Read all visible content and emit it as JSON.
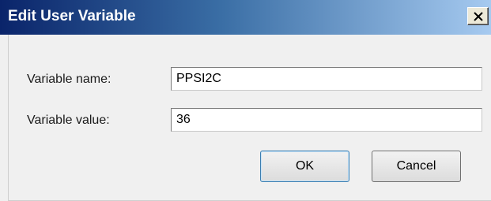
{
  "dialog": {
    "title": "Edit User Variable",
    "close_label": "X"
  },
  "fields": {
    "name_label": "Variable name:",
    "name_value": "PPSI2C",
    "value_label": "Variable value:",
    "value_value": "36"
  },
  "buttons": {
    "ok_label": "OK",
    "cancel_label": "Cancel"
  },
  "colors": {
    "titlebar_start": "#0a246a",
    "titlebar_end": "#a6caf0",
    "dialog_bg": "#f0f0f0"
  }
}
